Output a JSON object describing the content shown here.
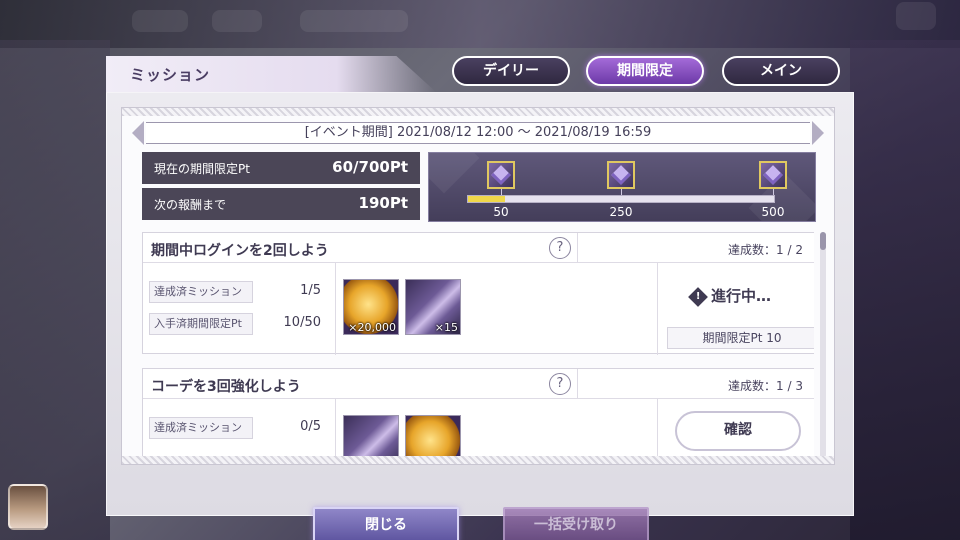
{
  "window": {
    "title": "ミッション"
  },
  "tabs": [
    {
      "label": "デイリー",
      "active": false
    },
    {
      "label": "期間限定",
      "active": true
    },
    {
      "label": "メイン",
      "active": false
    }
  ],
  "event": {
    "period": "[イベント期間] 2021/08/12 12:00 ～ 2021/08/19 16:59"
  },
  "points": {
    "current_label": "現在の期間限定Pt",
    "current_value": "60/700Pt",
    "next_label": "次の報酬まで",
    "next_value": "190Pt"
  },
  "progress": {
    "fraction": 0.12,
    "milestones": [
      {
        "label": "50",
        "icon": "crystal-icon"
      },
      {
        "label": "250",
        "icon": "crystal-icon"
      },
      {
        "label": "500",
        "icon": "crystal-icon"
      }
    ]
  },
  "missions": [
    {
      "title": "期間中ログインを2回しよう",
      "help": "?",
      "achievement": "達成数：1 / 2",
      "stats": [
        {
          "label": "達成済ミッション",
          "value": "1/5"
        },
        {
          "label": "入手済期間限定Pt",
          "value": "10/50"
        }
      ],
      "rewards": [
        {
          "icon": "coin-icon",
          "qty": "×20,000"
        },
        {
          "icon": "ticket-icon",
          "qty": "×15"
        }
      ],
      "status": "進行中…",
      "reward_pt": "期間限定Pt 10"
    },
    {
      "title": "コーデを3回強化しよう",
      "help": "?",
      "achievement": "達成数：1 / 3",
      "stats": [
        {
          "label": "達成済ミッション",
          "value": "0/5"
        }
      ],
      "rewards": [
        {
          "icon": "ticket-icon",
          "qty": ""
        },
        {
          "icon": "coin-icon",
          "qty": ""
        }
      ],
      "action": "確認"
    }
  ],
  "buttons": {
    "close": "閉じる",
    "claim_all": "一括受け取り"
  },
  "colors": {
    "accent": "#8a55c8",
    "panel_dark": "#4b4657",
    "progress_fill": "#f0d84a"
  }
}
